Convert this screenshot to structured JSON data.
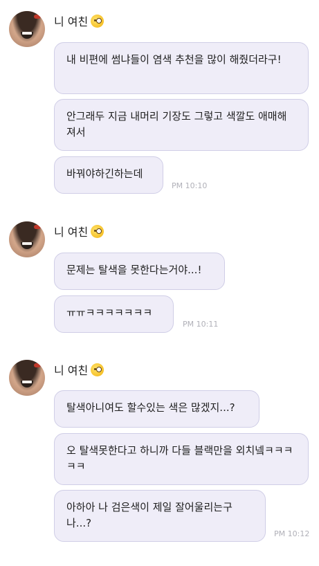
{
  "groups": [
    {
      "sender": {
        "name": "니 여친",
        "emoji": "face-with-monocle"
      },
      "messages": [
        {
          "text": "내 비편에 썸냐들이 염색 추천을 많이 해줬더라구!"
        },
        {
          "text": "안그래두 지금 내머리 기장도 그렇고 색깔도 애매해져서"
        },
        {
          "text": "바꿔야하긴하는데"
        }
      ],
      "time": "PM 10:10"
    },
    {
      "sender": {
        "name": "니 여친",
        "emoji": "face-with-monocle"
      },
      "messages": [
        {
          "text": "문제는 탈색을 못한다는거야...!"
        },
        {
          "text": "ㅠㅠㅋㅋㅋㅋㅋㅋㅋ"
        }
      ],
      "time": "PM 10:11"
    },
    {
      "sender": {
        "name": "니 여친",
        "emoji": "face-with-monocle"
      },
      "messages": [
        {
          "text": "탈색아니여도 할수있는 색은 많겠지...?"
        },
        {
          "text": "오 탈색못한다고 하니까 다들 블랙만을 외치넼ㅋㅋㅋㅋㅋ"
        },
        {
          "text": "아하아 나 검은색이 제일 잘어울리는구나...?"
        }
      ],
      "time": "PM 10:12"
    }
  ]
}
